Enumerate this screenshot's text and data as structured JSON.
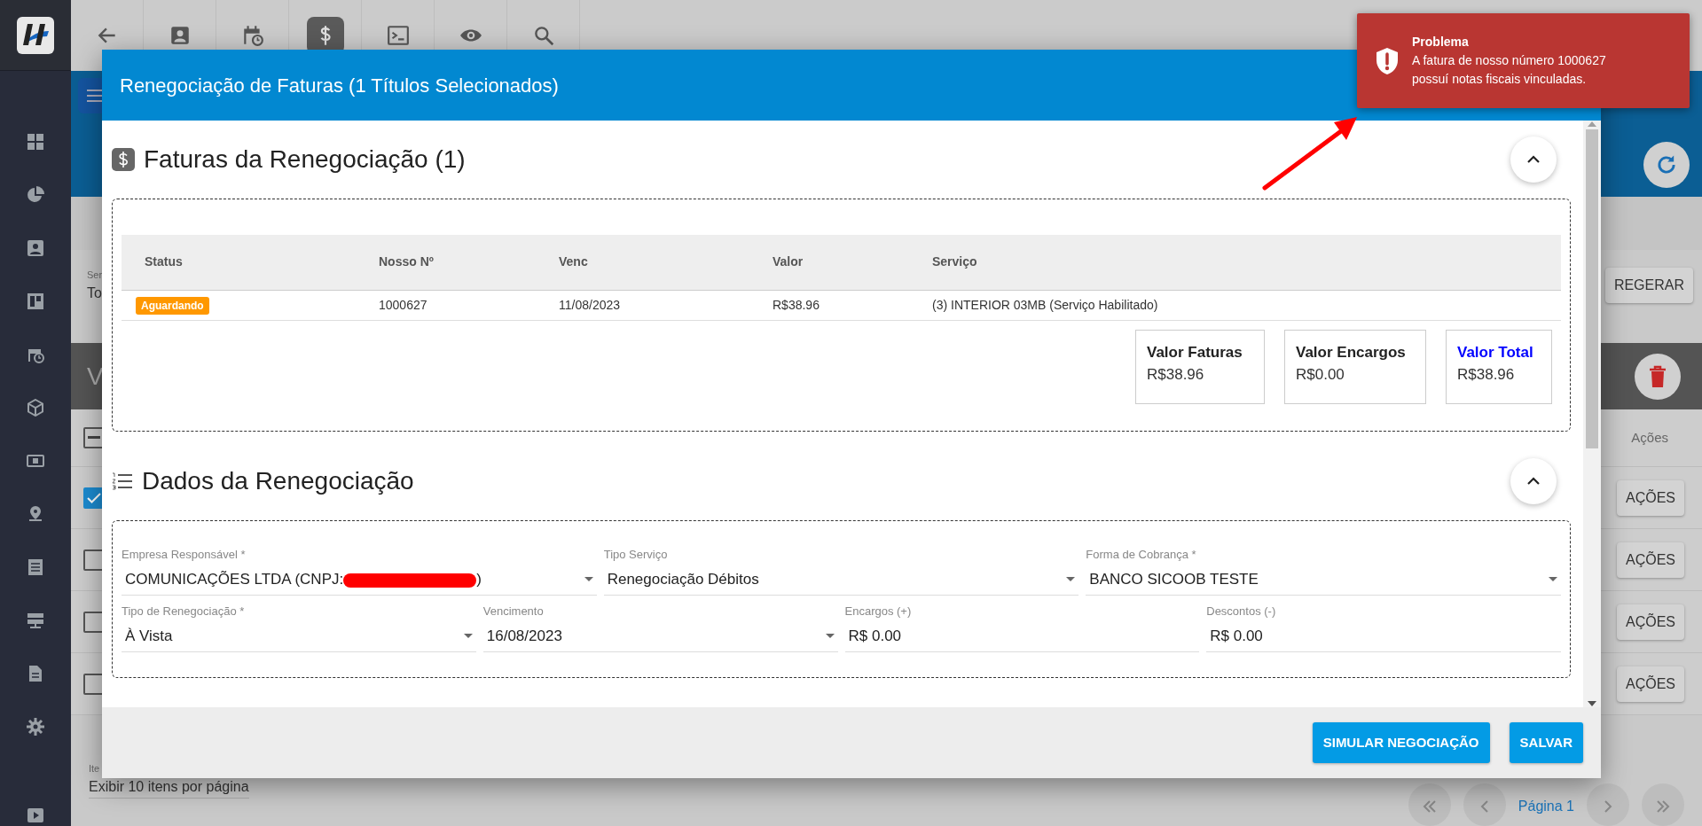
{
  "toolbar": [
    {
      "selected": false
    },
    {
      "selected": false
    },
    {
      "selected": false
    },
    {
      "selected": true
    },
    {
      "selected": false
    },
    {
      "selected": false
    },
    {
      "selected": false
    }
  ],
  "background": {
    "filter_label": "Ser",
    "filter_value": "To",
    "regenerate_button": "REGERAR",
    "section_title": "V",
    "list_header": "Ações",
    "select_all": {
      "indeterminate": true
    },
    "rows": [
      {
        "checked": true,
        "action": "AÇÕES"
      },
      {
        "checked": false,
        "action": "AÇÕES"
      },
      {
        "checked": false,
        "action": "AÇÕES"
      },
      {
        "checked": false,
        "action": "AÇÕES"
      }
    ],
    "page_size_label": "Ite",
    "page_size_value": "Exibir 10 itens por página",
    "page_label": "Página 1"
  },
  "modal": {
    "title": "Renegociação de Faturas (1 Títulos Selecionados)",
    "invoices_section": {
      "title": "Faturas da Renegociação (1)",
      "expanded": true,
      "table": {
        "columns": [
          "Status",
          "Nosso Nº",
          "Venc",
          "Valor",
          "Serviço"
        ],
        "rows": [
          {
            "status": "Aguardando",
            "nosso_numero": "1000627",
            "venc": "11/08/2023",
            "valor": "R$38.96",
            "servico": "(3) INTERIOR 03MB (Serviço Habilitado)"
          }
        ]
      },
      "totals": [
        {
          "label": "Valor Faturas",
          "value": "R$38.96",
          "emphasized": false
        },
        {
          "label": "Valor Encargos",
          "value": "R$0.00",
          "emphasized": false
        },
        {
          "label": "Valor Total",
          "value": "R$38.96",
          "emphasized": true
        }
      ]
    },
    "details_section": {
      "title": "Dados da Renegociação",
      "expanded": true,
      "primary_fields": [
        {
          "label": "Empresa Responsável *",
          "value": "COMUNICAÇÕES LTDA (CNPJ:",
          "redacted": true,
          "value_suffix": ")",
          "kind": "select"
        },
        {
          "label": "Tipo Serviço",
          "value": "Renegociação Débitos",
          "kind": "select"
        },
        {
          "label": "Forma de Cobrança *",
          "value": "BANCO SICOOB TESTE",
          "kind": "select"
        }
      ],
      "secondary_fields": [
        {
          "label": "Tipo de Renegociação *",
          "value": "À Vista",
          "kind": "select"
        },
        {
          "label": "Vencimento",
          "value": "16/08/2023",
          "kind": "select"
        },
        {
          "label": "Encargos (+)",
          "value": "R$ 0.00",
          "kind": "text"
        },
        {
          "label": "Descontos (-)",
          "value": "R$ 0.00",
          "kind": "text"
        }
      ]
    },
    "buttons": [
      "SIMULAR NEGOCIAÇÃO",
      "SALVAR"
    ]
  },
  "toast": {
    "title": "Problema",
    "message": "A fatura de nosso número 1000627 possuí notas fiscais vinculadas."
  }
}
